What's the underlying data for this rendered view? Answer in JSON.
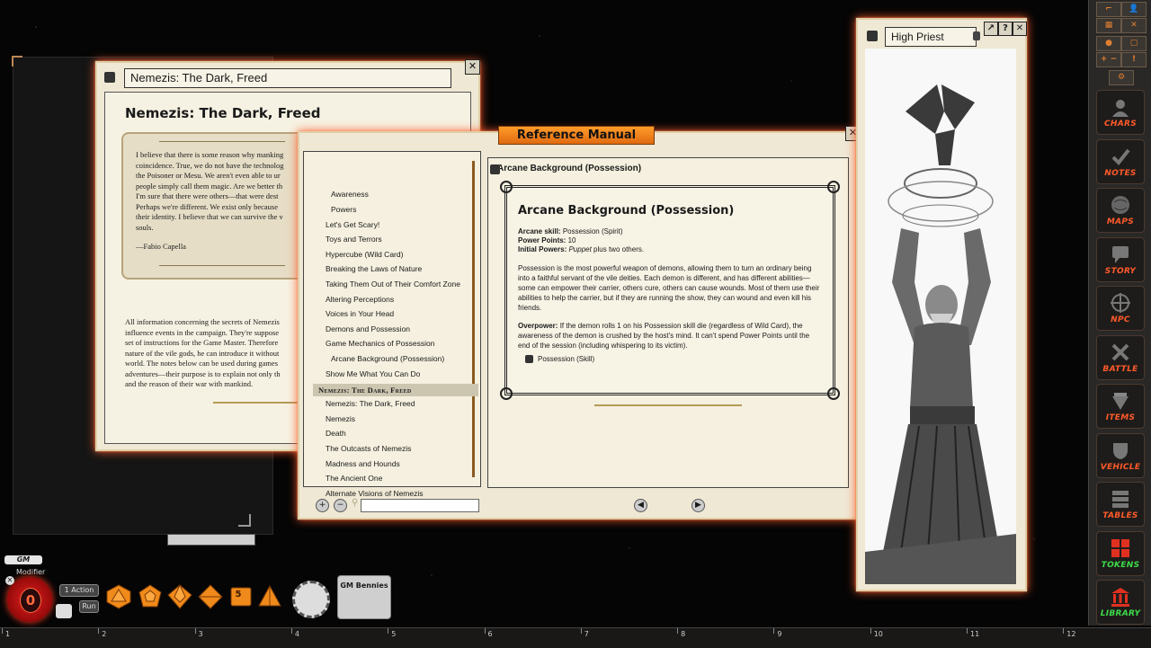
{
  "story_window": {
    "title_field": "Nemezis: The Dark, Freed",
    "heading": "Nemezis: The Dark, Freed",
    "quote_text": "I believe that there is some reason why manking\ncoincidence. True, we do not have the technolog\nthe Poisoner or Mesu. We aren't even able to ur\npeople simply call them magic. Are we better th\nI'm sure that there were others—that were dest\nPerhaps we're different. We exist only because\ntheir identity. I believe that we can survive the v\nsouls.",
    "quote_author": "—Fabio Capella",
    "paragraph": "All information concerning the secrets of Nemezis\ninfluence events in the campaign. They're suppose\nset of instructions for the Game Master. Therefore\nnature of the vile gods, he can introduce it without\nworld. The notes below can be used during games\nadventures—their purpose is to explain not only th\nand the reason of their war with mankind.",
    "close": "✕",
    "nav_arrow": "◀"
  },
  "reference_manual": {
    "title": "Reference Manual",
    "close": "✕",
    "list_items": [
      {
        "label": "Awareness",
        "indent": true
      },
      {
        "label": "Powers",
        "indent": true
      },
      {
        "label": "Let's Get Scary!"
      },
      {
        "label": "Toys and Terrors"
      },
      {
        "label": "Hypercube (Wild Card)"
      },
      {
        "label": "Breaking the Laws of Nature"
      },
      {
        "label": "Taking Them Out of Their Comfort Zone"
      },
      {
        "label": "Altering Perceptions"
      },
      {
        "label": "Voices in Your Head"
      },
      {
        "label": "Demons and Possession"
      },
      {
        "label": "Game Mechanics of Possession"
      },
      {
        "label": "Arcane Background (Possession)",
        "indent": true
      },
      {
        "label": "Show Me What You Can Do"
      },
      {
        "label": "Nemezis: The Dark, Freed",
        "selected": true
      },
      {
        "label": "Nemezis: The Dark, Freed"
      },
      {
        "label": "Nemezis"
      },
      {
        "label": "Death"
      },
      {
        "label": "The Outcasts of Nemezis"
      },
      {
        "label": "Madness and Hounds"
      },
      {
        "label": "The Ancient One"
      },
      {
        "label": "Alternate Visions of Nemezis"
      }
    ],
    "content_header": "Arcane Background (Possession)",
    "box_title": "Arcane Background (Possession)",
    "arcane_skill_label": "Arcane skill:",
    "arcane_skill_value": "Possession (Spirit)",
    "power_points_label": "Power Points:",
    "power_points_value": "10",
    "initial_powers_label": "Initial Powers:",
    "initial_powers_value_italic": "Puppet",
    "initial_powers_value_rest": " plus two others.",
    "para1": "Possession is the most powerful weapon of demons, allowing them to turn an ordinary being into a faithful servant of the vile deities. Each demon is different, and has different abilities—some can empower their carrier, others cure, others can cause wounds. Most of them use their abilities to help the carrier, but if they are running the show, they can wound and even kill his friends.",
    "overpower_label": "Overpower:",
    "overpower_text": " If the demon rolls 1 on his Possession skill die (regardless of Wild Card), the awareness of the demon is crushed by the host's mind. It can't spend Power Points until the end of the session (including whispering to its victim).",
    "link_label": "Possession (Skill)",
    "search_value": "",
    "add_btn": "+",
    "remove_btn": "−",
    "prev": "◀",
    "next": "▶"
  },
  "priest_window": {
    "title": "High Priest",
    "btn_link": "↗",
    "btn_help": "?",
    "btn_close": "✕"
  },
  "toolbar": {
    "mini": [
      "⌐",
      "👤",
      "▦",
      "✕",
      "●",
      "▢",
      "+ −",
      "!",
      "⚙"
    ],
    "buttons": [
      {
        "label": "CHARS",
        "icon": "chars-icon"
      },
      {
        "label": "NOTES",
        "icon": "check-icon"
      },
      {
        "label": "MAPS",
        "icon": "globe-icon"
      },
      {
        "label": "STORY",
        "icon": "speech-icon"
      },
      {
        "label": "NPC",
        "icon": "crosshair-icon"
      },
      {
        "label": "BATTLE",
        "icon": "swords-icon"
      },
      {
        "label": "ITEMS",
        "icon": "gem-icon"
      },
      {
        "label": "VEHICLE",
        "icon": "shield-icon"
      },
      {
        "label": "TABLES",
        "icon": "table-icon"
      },
      {
        "label": "TOKENS",
        "icon": "tokens-icon"
      },
      {
        "label": "LIBRARY",
        "icon": "library-icon"
      }
    ]
  },
  "bottom": {
    "gm_label": "GM",
    "modifier_label": "Modifier",
    "modifier_value": "0",
    "action_btn": "1 Action",
    "run_btn": "Run",
    "die_d12_label": "5",
    "gm_bennies": "GM Bennies",
    "ruler": [
      "1",
      "2",
      "3",
      "4",
      "5",
      "6",
      "7",
      "8",
      "9",
      "10",
      "11",
      "12"
    ]
  },
  "colors": {
    "accent_orange": "#ff5a2a",
    "toolbar_label": "#ff5a2a",
    "tokens_green": "#3ddc4a",
    "title_tab": "#ff9c2a"
  }
}
